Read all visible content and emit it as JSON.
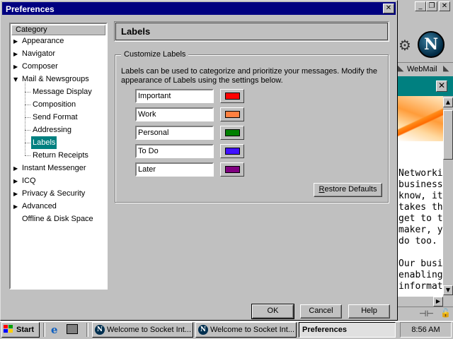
{
  "dialog": {
    "title": "Preferences",
    "close_glyph": "✕"
  },
  "category": {
    "header": "Category",
    "items": [
      {
        "label": "Appearance",
        "expander": "▶"
      },
      {
        "label": "Navigator",
        "expander": "▶"
      },
      {
        "label": "Composer",
        "expander": "▶"
      },
      {
        "label": "Mail & Newsgroups",
        "expander": "▼"
      },
      {
        "label": "Message Display"
      },
      {
        "label": "Composition"
      },
      {
        "label": "Send Format"
      },
      {
        "label": "Addressing"
      },
      {
        "label": "Labels",
        "selected": true
      },
      {
        "label": "Return Receipts"
      },
      {
        "label": "Instant Messenger",
        "expander": "▶"
      },
      {
        "label": "ICQ",
        "expander": "▶"
      },
      {
        "label": "Privacy & Security",
        "expander": "▶"
      },
      {
        "label": "Advanced",
        "expander": "▶"
      },
      {
        "label": "Offline & Disk Space"
      }
    ]
  },
  "panel": {
    "title": "Labels",
    "group_legend": "Customize Labels",
    "intro": "Labels can be used to categorize and prioritize your messages. Modify the appearance of Labels using the settings below.",
    "labels": [
      {
        "name": "Important",
        "color": "#ff0000"
      },
      {
        "name": "Work",
        "color": "#ff8040"
      },
      {
        "name": "Personal",
        "color": "#008000"
      },
      {
        "name": "To Do",
        "color": "#4010ff"
      },
      {
        "name": "Later",
        "color": "#800080"
      }
    ],
    "restore_defaults_accel": "R",
    "restore_defaults_rest": "estore Defaults"
  },
  "buttons": {
    "ok": "OK",
    "cancel": "Cancel",
    "help": "Help"
  },
  "browser": {
    "min_glyph": "_",
    "max_glyph": "❐",
    "close_glyph": "✕",
    "logo_letter": "N",
    "webmail": "WebMail",
    "sidebar_close": "✕",
    "body_lines": [
      "Networkin",
      "business.",
      "know, it's",
      "takes the",
      "get to th",
      "maker, yo",
      "do too.",
      "",
      "Our busin",
      "enabling ",
      "informatio"
    ]
  },
  "taskbar": {
    "start": "Start",
    "tasks": [
      "Welcome to Socket Int...",
      "Welcome to Socket Int...",
      "Preferences"
    ],
    "clock": "8:56 AM"
  }
}
